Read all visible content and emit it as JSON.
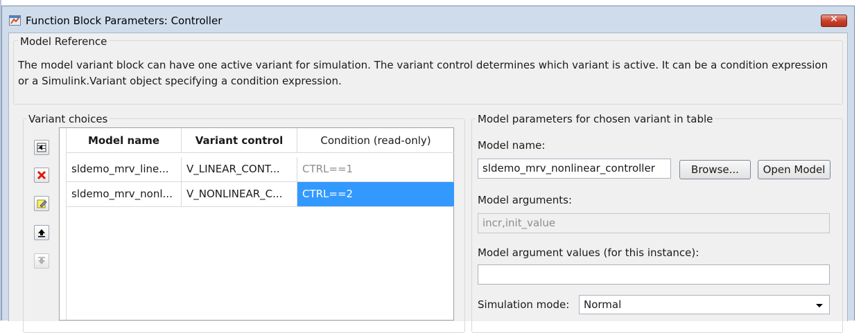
{
  "window": {
    "title": "Function Block Parameters: Controller",
    "close_label": "✕"
  },
  "model_reference": {
    "label": "Model Reference",
    "description": "The model variant block can have one active variant for simulation. The variant control determines which variant is active. It can be a condition expression or a Simulink.Variant object specifying a condition expression."
  },
  "variant_choices": {
    "label": "Variant choices",
    "toolbar": [
      {
        "name": "add-variant-icon",
        "enabled": true
      },
      {
        "name": "delete-variant-icon",
        "enabled": true
      },
      {
        "name": "edit-variant-icon",
        "enabled": true
      },
      {
        "name": "move-up-icon",
        "enabled": true
      },
      {
        "name": "move-down-icon",
        "enabled": false
      }
    ],
    "columns": [
      "Model name",
      "Variant control",
      "Condition (read-only)"
    ],
    "rows": [
      {
        "model": "sldemo_mrv_line...",
        "control": "V_LINEAR_CONT...",
        "condition": "CTRL==1",
        "selected": false
      },
      {
        "model": "sldemo_mrv_nonl...",
        "control": "V_NONLINEAR_C...",
        "condition": "CTRL==2",
        "selected": true
      }
    ]
  },
  "model_params": {
    "label": "Model parameters for chosen variant in table",
    "model_name_label": "Model name:",
    "model_name_value": "sldemo_mrv_nonlinear_controller",
    "browse_label": "Browse...",
    "open_model_label": "Open Model",
    "model_arguments_label": "Model arguments:",
    "model_arguments_value": "incr,init_value",
    "arg_values_label": "Model argument values (for this instance):",
    "arg_values_value": "",
    "sim_mode_label": "Simulation mode:",
    "sim_mode_value": "Normal"
  },
  "colors": {
    "selection": "#3399ff",
    "title_bar": "#cfdcec",
    "close_button": "#c7422c"
  }
}
